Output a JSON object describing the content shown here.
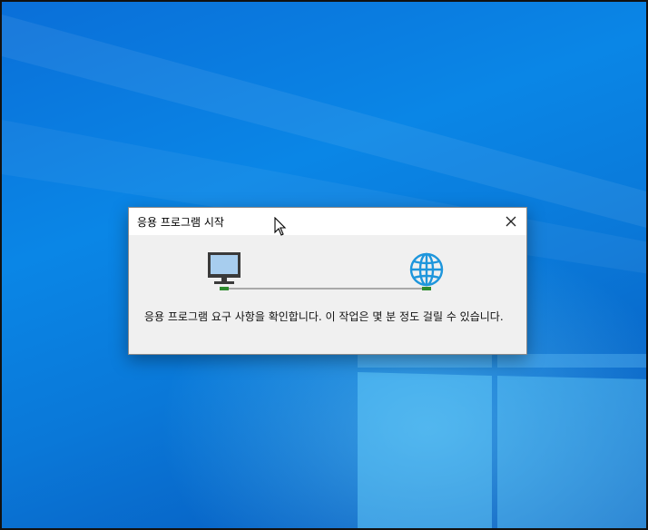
{
  "dialog": {
    "title": "응용 프로그램 시작",
    "message": "응용 프로그램 요구 사항을 확인합니다. 이 작업은 몇 분 정도 걸릴 수 있습니다.",
    "close_icon": "close-icon"
  },
  "graphic": {
    "left_icon": "computer-icon",
    "right_icon": "globe-icon"
  },
  "colors": {
    "accent_blue": "#1e96dc",
    "connector_green": "#2e8b2e",
    "monitor_screen": "#a7cdee"
  }
}
